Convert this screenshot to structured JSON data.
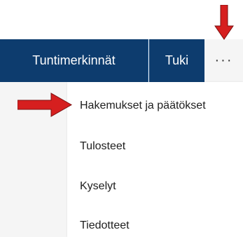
{
  "navbar": {
    "items": [
      {
        "label": "Tuntimerkinnät"
      },
      {
        "label": "Tuki"
      }
    ],
    "more_label": "···"
  },
  "dropdown": {
    "items": [
      {
        "label": "Hakemukset ja päätökset"
      },
      {
        "label": "Tulosteet"
      },
      {
        "label": "Kyselyt"
      },
      {
        "label": "Tiedotteet"
      }
    ]
  },
  "colors": {
    "nav_bg": "#0d3c6e",
    "arrow": "#d61f1f"
  }
}
